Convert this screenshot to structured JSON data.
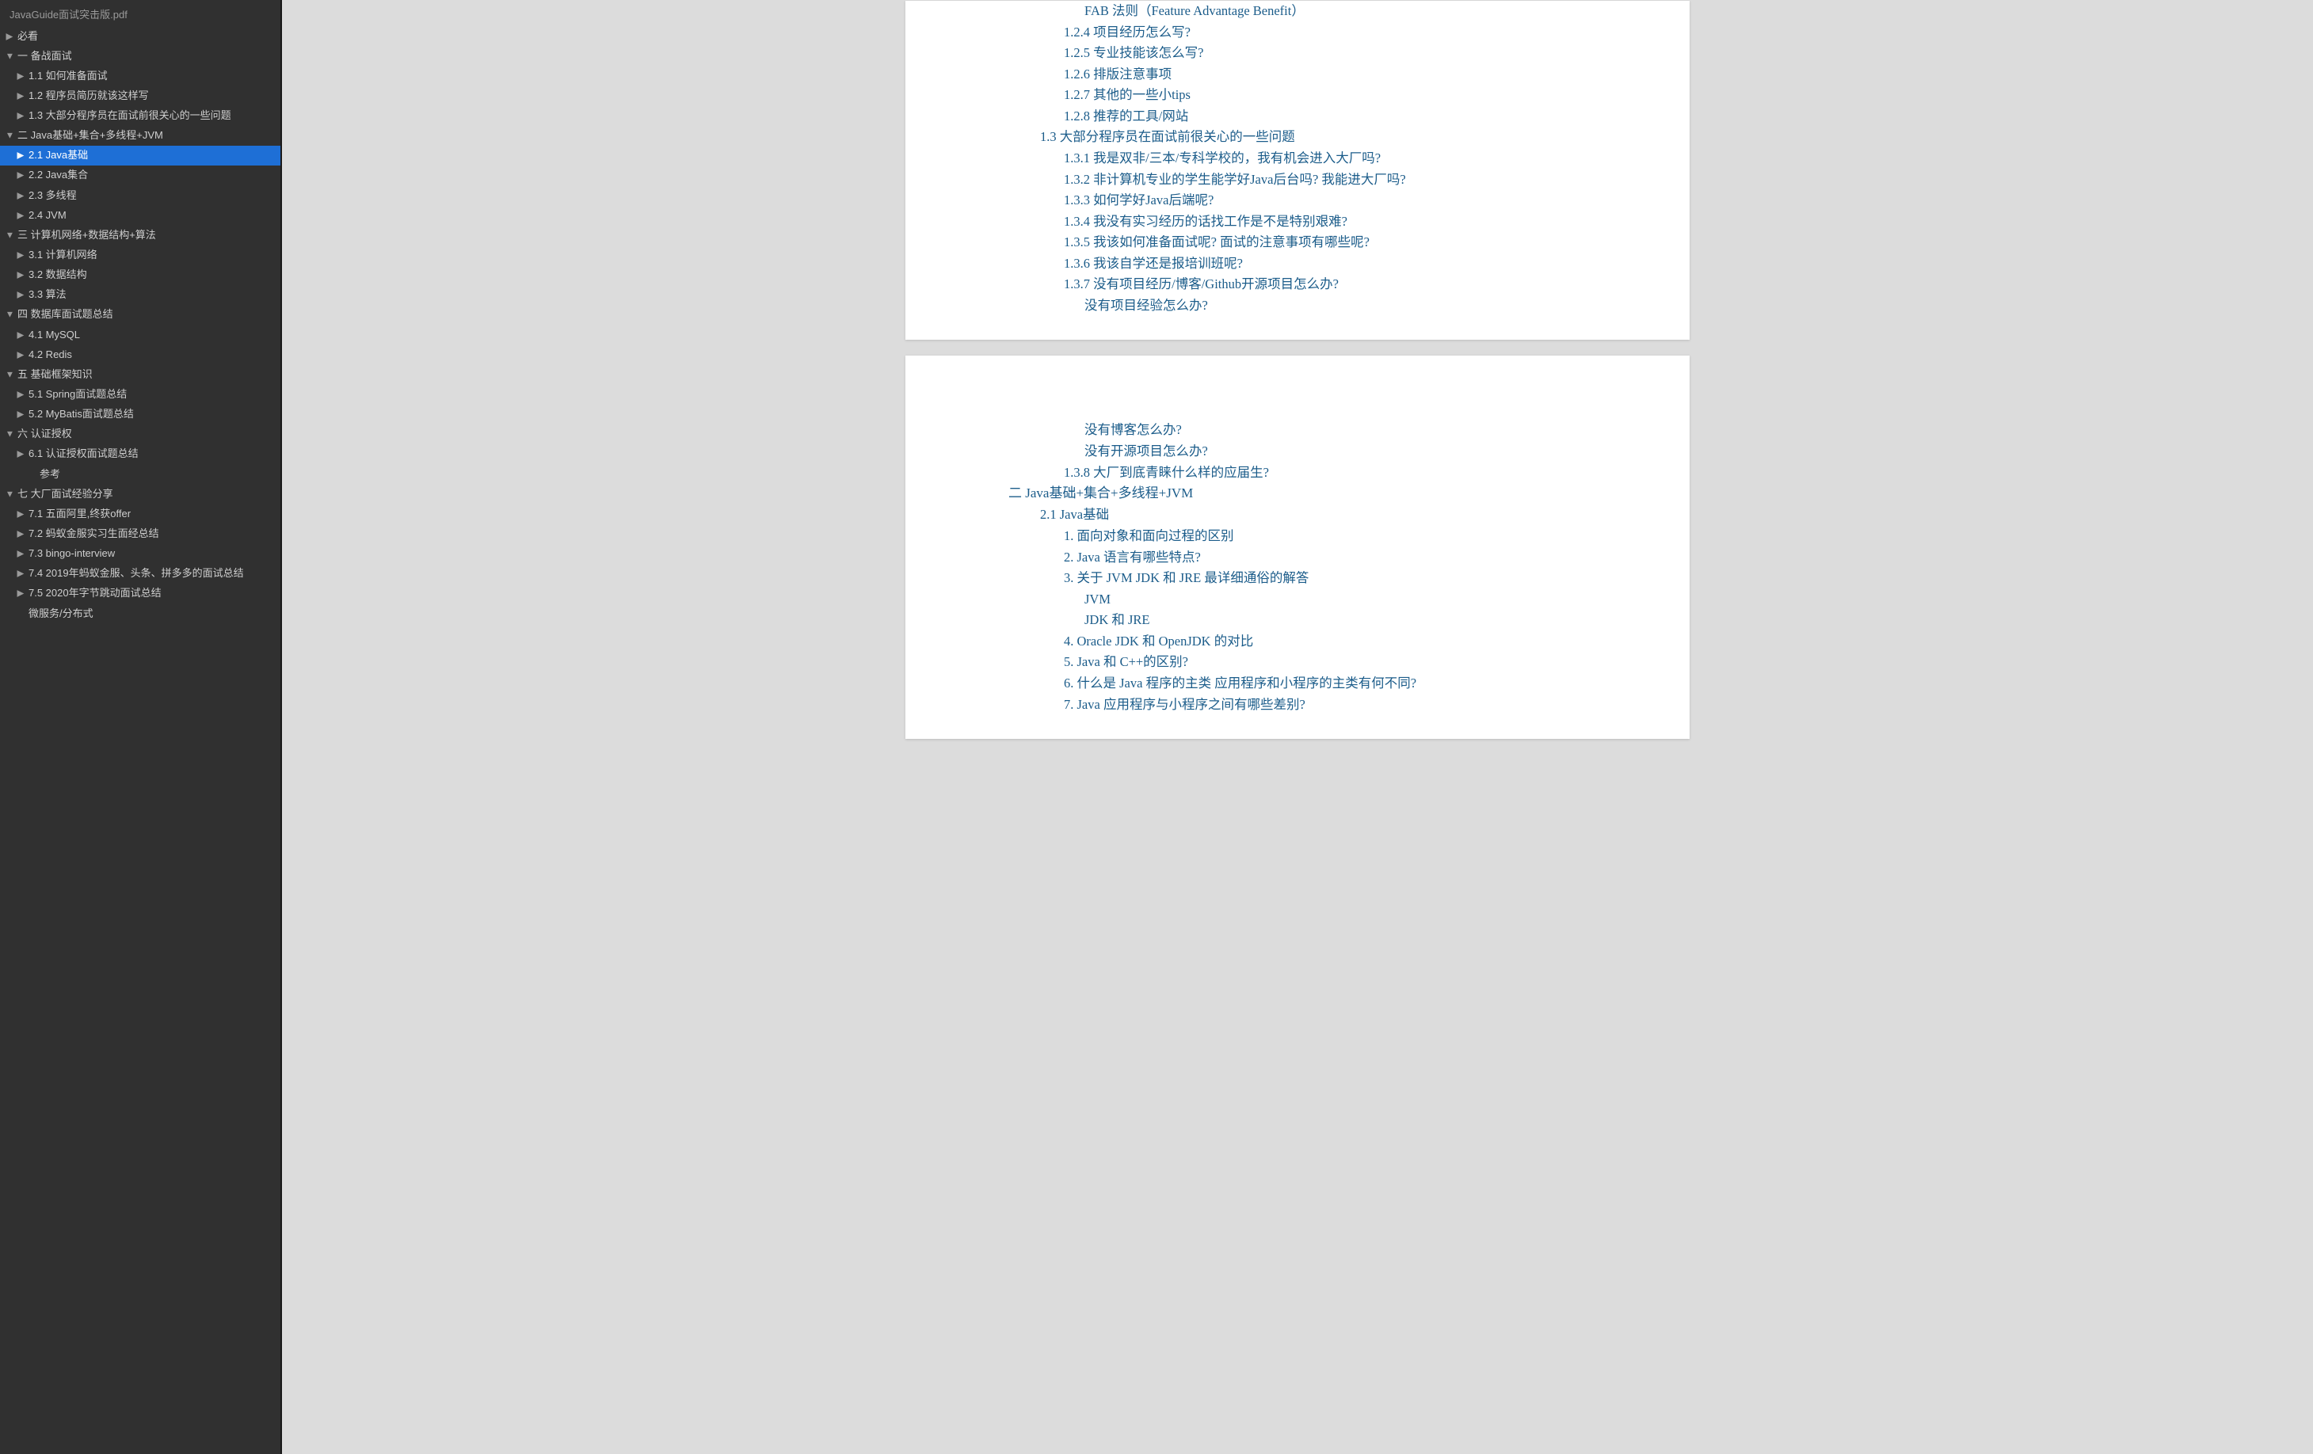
{
  "file_title": "JavaGuide面试突击版.pdf",
  "sidebar": [
    {
      "lvl": 0,
      "icon": "▶",
      "label": "必看",
      "sel": false
    },
    {
      "lvl": 0,
      "icon": "▼",
      "label": "一 备战面试",
      "sel": false
    },
    {
      "lvl": 1,
      "icon": "▶",
      "label": "1.1 如何准备面试",
      "sel": false
    },
    {
      "lvl": 1,
      "icon": "▶",
      "label": "1.2 程序员简历就该这样写",
      "sel": false
    },
    {
      "lvl": 1,
      "icon": "▶",
      "label": "1.3 大部分程序员在面试前很关心的一些问题",
      "sel": false
    },
    {
      "lvl": 0,
      "icon": "▼",
      "label": "二 Java基础+集合+多线程+JVM",
      "sel": false
    },
    {
      "lvl": 1,
      "icon": "▶",
      "label": "2.1 Java基础",
      "sel": true
    },
    {
      "lvl": 1,
      "icon": "▶",
      "label": "2.2 Java集合",
      "sel": false
    },
    {
      "lvl": 1,
      "icon": "▶",
      "label": "2.3 多线程",
      "sel": false
    },
    {
      "lvl": 1,
      "icon": "▶",
      "label": "2.4 JVM",
      "sel": false
    },
    {
      "lvl": 0,
      "icon": "▼",
      "label": "三 计算机网络+数据结构+算法",
      "sel": false
    },
    {
      "lvl": 1,
      "icon": "▶",
      "label": "3.1 计算机网络",
      "sel": false
    },
    {
      "lvl": 1,
      "icon": "▶",
      "label": "3.2 数据结构",
      "sel": false
    },
    {
      "lvl": 1,
      "icon": "▶",
      "label": "3.3 算法",
      "sel": false
    },
    {
      "lvl": 0,
      "icon": "▼",
      "label": "四 数据库面试题总结",
      "sel": false
    },
    {
      "lvl": 1,
      "icon": "▶",
      "label": "4.1 MySQL",
      "sel": false
    },
    {
      "lvl": 1,
      "icon": "▶",
      "label": "4.2 Redis",
      "sel": false
    },
    {
      "lvl": 0,
      "icon": "▼",
      "label": "五 基础框架知识",
      "sel": false
    },
    {
      "lvl": 1,
      "icon": "▶",
      "label": "5.1 Spring面试题总结",
      "sel": false
    },
    {
      "lvl": 1,
      "icon": "▶",
      "label": "5.2 MyBatis面试题总结",
      "sel": false
    },
    {
      "lvl": 0,
      "icon": "▼",
      "label": "六 认证授权",
      "sel": false
    },
    {
      "lvl": 1,
      "icon": "▶",
      "label": "6.1 认证授权面试题总结",
      "sel": false
    },
    {
      "lvl": 2,
      "icon": "",
      "label": "参考",
      "sel": false
    },
    {
      "lvl": 0,
      "icon": "▼",
      "label": "七 大厂面试经验分享",
      "sel": false
    },
    {
      "lvl": 1,
      "icon": "▶",
      "label": "7.1 五面阿里,终获offer",
      "sel": false
    },
    {
      "lvl": 1,
      "icon": "▶",
      "label": "7.2 蚂蚁金服实习生面经总结",
      "sel": false
    },
    {
      "lvl": 1,
      "icon": "▶",
      "label": "7.3 bingo-interview",
      "sel": false
    },
    {
      "lvl": 1,
      "icon": "▶",
      "label": "7.4 2019年蚂蚁金服、头条、拼多多的面试总结",
      "sel": false
    },
    {
      "lvl": 1,
      "icon": "▶",
      "label": "7.5 2020年字节跳动面试总结",
      "sel": false
    },
    {
      "lvl": 1,
      "icon": "",
      "label": "微服务/分布式",
      "sel": false
    }
  ],
  "page1": [
    {
      "lvl": 5,
      "text": "FAB 法则（Feature Advantage Benefit）"
    },
    {
      "lvl": 3,
      "text": "1.2.4 项目经历怎么写?"
    },
    {
      "lvl": 3,
      "text": "1.2.5 专业技能该怎么写?"
    },
    {
      "lvl": 3,
      "text": "1.2.6 排版注意事项"
    },
    {
      "lvl": 3,
      "text": "1.2.7 其他的一些小tips"
    },
    {
      "lvl": 3,
      "text": "1.2.8 推荐的工具/网站"
    },
    {
      "lvl": 2,
      "text": "1.3 大部分程序员在面试前很关心的一些问题"
    },
    {
      "lvl": 3,
      "text": "1.3.1 我是双非/三本/专科学校的，我有机会进入大厂吗?"
    },
    {
      "lvl": 3,
      "text": "1.3.2 非计算机专业的学生能学好Java后台吗?  我能进大厂吗?"
    },
    {
      "lvl": 3,
      "text": "1.3.3 如何学好Java后端呢?"
    },
    {
      "lvl": 3,
      "text": "1.3.4 我没有实习经历的话找工作是不是特别艰难?"
    },
    {
      "lvl": 3,
      "text": "1.3.5 我该如何准备面试呢?  面试的注意事项有哪些呢?"
    },
    {
      "lvl": 3,
      "text": "1.3.6 我该自学还是报培训班呢?"
    },
    {
      "lvl": 3,
      "text": "1.3.7 没有项目经历/博客/Github开源项目怎么办?"
    },
    {
      "lvl": 4,
      "text": "没有项目经验怎么办?"
    }
  ],
  "page2": [
    {
      "lvl": 4,
      "text": "没有博客怎么办?"
    },
    {
      "lvl": 4,
      "text": "没有开源项目怎么办?"
    },
    {
      "lvl": 3,
      "text": "1.3.8 大厂到底青睐什么样的应届生?"
    },
    {
      "lvl": 1,
      "text": "二 Java基础+集合+多线程+JVM"
    },
    {
      "lvl": 2,
      "text": "2.1 Java基础"
    },
    {
      "lvl": 3,
      "text": "1. 面向对象和面向过程的区别"
    },
    {
      "lvl": 3,
      "text": "2. Java 语言有哪些特点?"
    },
    {
      "lvl": 3,
      "text": "3. 关于 JVM JDK 和 JRE 最详细通俗的解答"
    },
    {
      "lvl": 4,
      "text": "JVM"
    },
    {
      "lvl": 4,
      "text": "JDK 和 JRE"
    },
    {
      "lvl": 3,
      "text": "4. Oracle JDK 和 OpenJDK 的对比"
    },
    {
      "lvl": 3,
      "text": "5. Java 和 C++的区别?"
    },
    {
      "lvl": 3,
      "text": "6. 什么是 Java 程序的主类 应用程序和小程序的主类有何不同?"
    },
    {
      "lvl": 3,
      "text": "7. Java 应用程序与小程序之间有哪些差别?"
    }
  ]
}
